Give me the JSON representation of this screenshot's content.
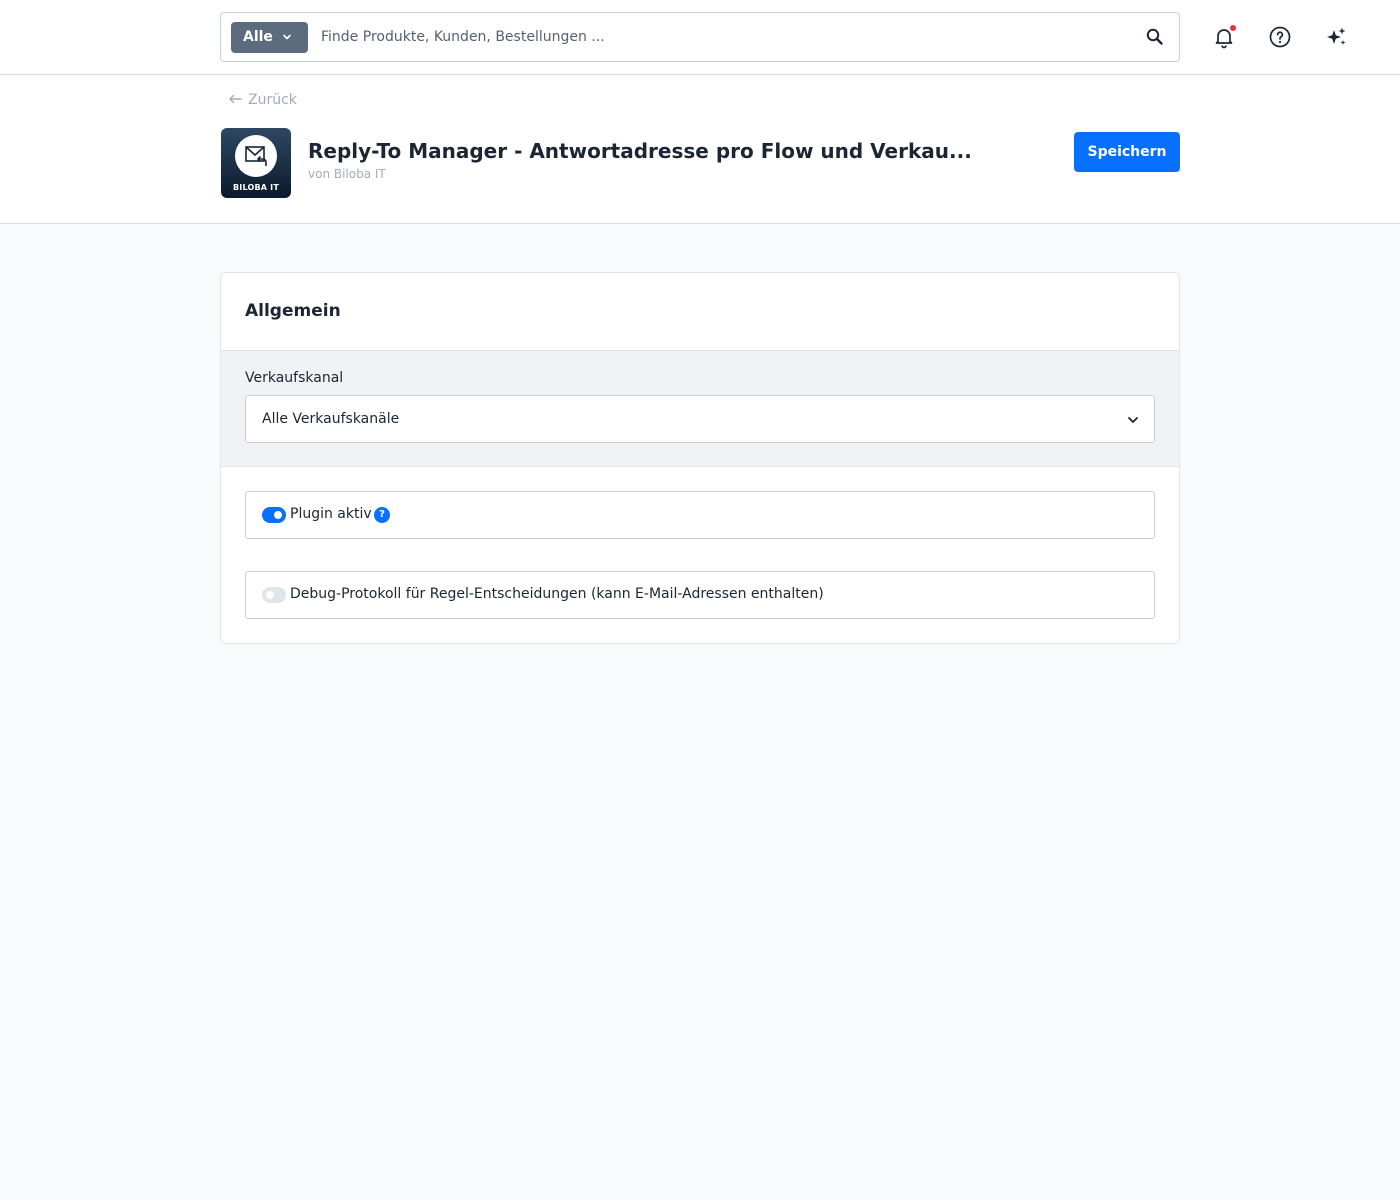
{
  "search": {
    "type_label": "Alle",
    "placeholder": "Finde Produkte, Kunden, Bestellungen ..."
  },
  "colors": {
    "accent": "#0870ff",
    "notification_dot": "#e3323c",
    "search_type_bg": "#5d6b7f"
  },
  "topbar_icons": [
    "search-icon",
    "bell-icon",
    "help-circle-icon",
    "sparkles-icon"
  ],
  "page": {
    "back_label": "Zurück",
    "plugin_logo_text": "BILOBA IT",
    "plugin_title": "Reply-To Manager - Antwortadresse pro Flow und Verkau...",
    "plugin_vendor": "von Biloba IT",
    "save_label": "Speichern"
  },
  "card": {
    "title": "Allgemein",
    "channel_label": "Verkaufskanal",
    "channel_value": "Alle Verkaufskanäle",
    "toggles": [
      {
        "label": "Plugin aktiv",
        "enabled": true,
        "help": "?"
      },
      {
        "label": "Debug-Protokoll für Regel-Entscheidungen (kann E-Mail-Adressen enthalten)",
        "enabled": false
      }
    ]
  }
}
